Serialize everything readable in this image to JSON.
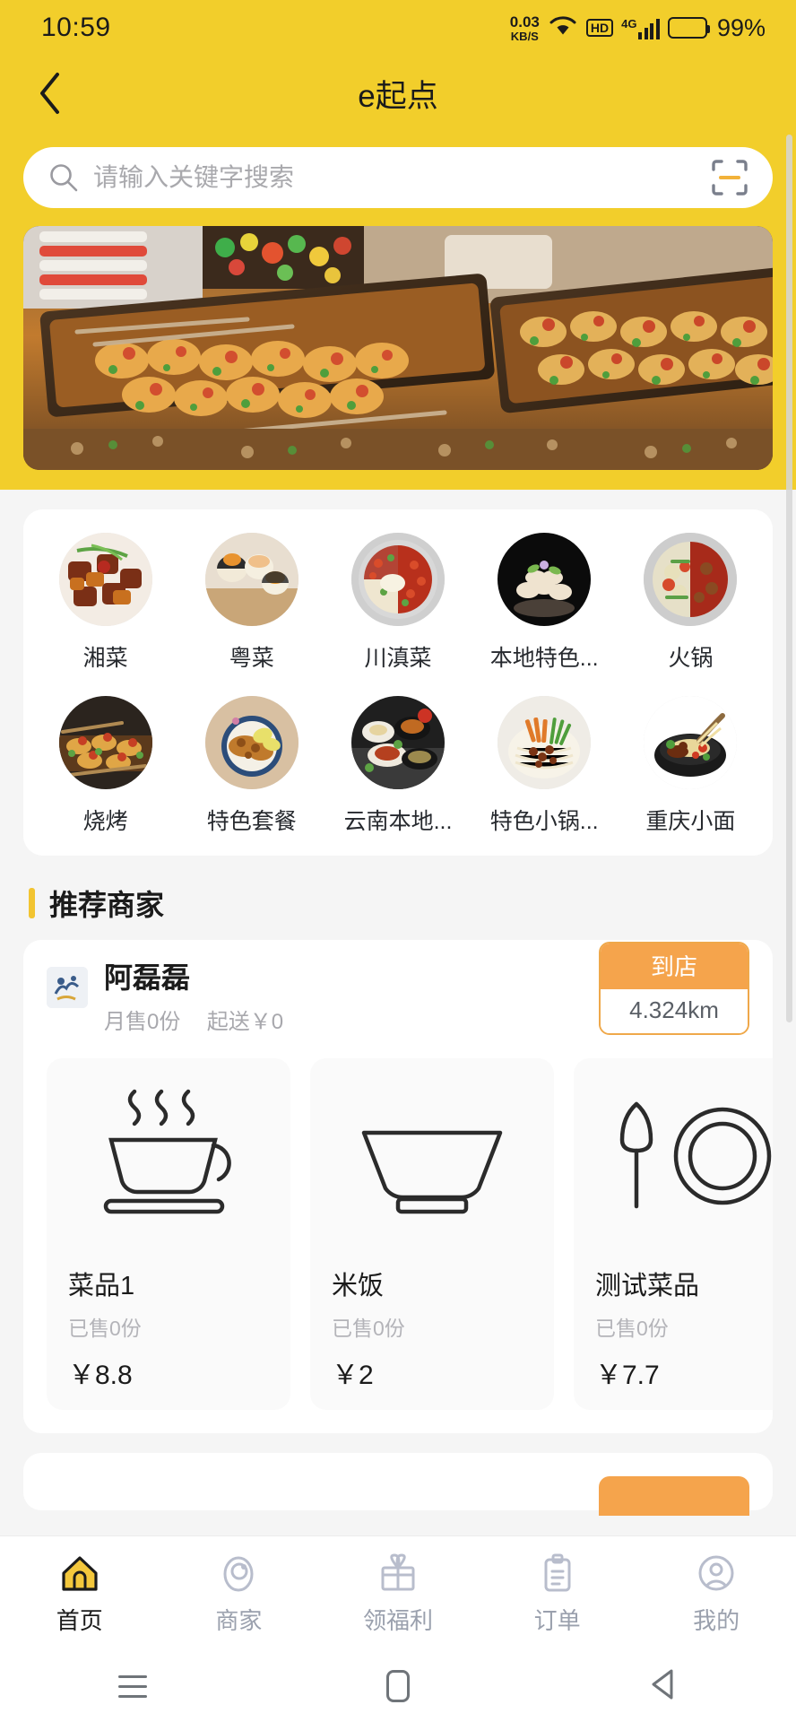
{
  "status_bar": {
    "time": "10:59",
    "net_speed_value": "0.03",
    "net_speed_unit": "KB/S",
    "hd_label": "HD",
    "network_type": "4G",
    "battery_percent": "99%"
  },
  "header": {
    "title": "e起点",
    "back_icon": "chevron-left-icon",
    "bg_color": "#F2CE2B"
  },
  "search": {
    "placeholder": "请输入关键字搜索",
    "value": "",
    "search_icon": "search-icon",
    "scan_icon": "scan-qr-icon"
  },
  "banner": {
    "alt": "grilled skewers food photo"
  },
  "categories": [
    {
      "label": "湘菜",
      "thumb": "braised-pork-photo"
    },
    {
      "label": "粤菜",
      "thumb": "sushi-photo"
    },
    {
      "label": "川滇菜",
      "thumb": "hotpot-photo"
    },
    {
      "label": "本地特色...",
      "thumb": "local-specialty-photo"
    },
    {
      "label": "火锅",
      "thumb": "mandarin-hotpot-photo"
    },
    {
      "label": "烧烤",
      "thumb": "bbq-photo"
    },
    {
      "label": "特色套餐",
      "thumb": "set-meal-photo"
    },
    {
      "label": "云南本地...",
      "thumb": "yunnan-local-photo"
    },
    {
      "label": "特色小锅...",
      "thumb": "noodle-photo"
    },
    {
      "label": "重庆小面",
      "thumb": "chongqing-noodle-photo"
    }
  ],
  "recommend_section": {
    "title": "推荐商家",
    "accent_color": "#F2C431"
  },
  "merchant": {
    "name": "阿磊磊",
    "monthly_sales": "月售0份",
    "min_order": "起送￥0",
    "badge_label": "到店",
    "distance": "4.324km",
    "badge_color": "#F5A44C",
    "dishes": [
      {
        "name": "菜品1",
        "sold": "已售0份",
        "price": "￥8.8",
        "icon": "coffee-cup-icon"
      },
      {
        "name": "米饭",
        "sold": "已售0份",
        "price": "￥2",
        "icon": "rice-bowl-icon"
      },
      {
        "name": "测试菜品",
        "sold": "已售0份",
        "price": "￥7.7",
        "icon": "plate-knife-icon"
      }
    ]
  },
  "tabbar": {
    "active_color": "#F2C431",
    "inactive_color": "#9aa0ad",
    "items": [
      {
        "label": "首页",
        "icon": "home-icon",
        "active": true
      },
      {
        "label": "商家",
        "icon": "shop-icon",
        "active": false
      },
      {
        "label": "领福利",
        "icon": "gift-icon",
        "active": false
      },
      {
        "label": "订单",
        "icon": "clipboard-icon",
        "active": false
      },
      {
        "label": "我的",
        "icon": "user-circle-icon",
        "active": false
      }
    ]
  },
  "android_nav": {
    "recent_icon": "menu-icon",
    "home_icon": "square-icon",
    "back_icon": "triangle-back-icon"
  }
}
